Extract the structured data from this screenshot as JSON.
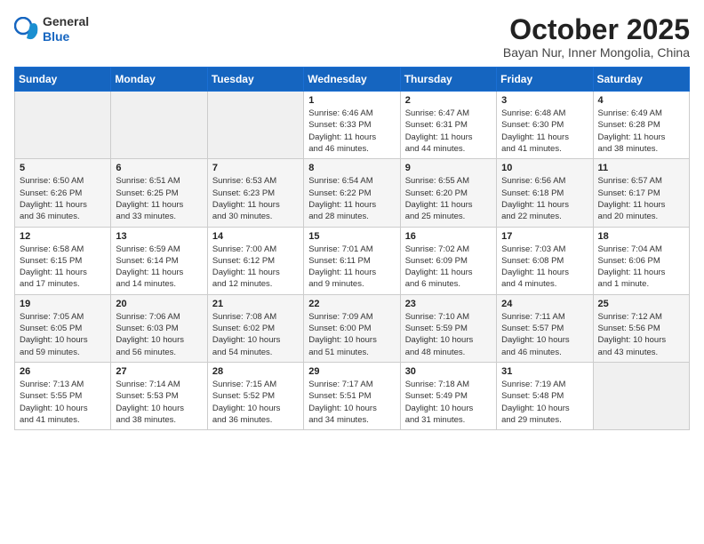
{
  "header": {
    "logo_line1": "General",
    "logo_line2": "Blue",
    "month": "October 2025",
    "location": "Bayan Nur, Inner Mongolia, China"
  },
  "weekdays": [
    "Sunday",
    "Monday",
    "Tuesday",
    "Wednesday",
    "Thursday",
    "Friday",
    "Saturday"
  ],
  "weeks": [
    [
      {
        "day": "",
        "info": ""
      },
      {
        "day": "",
        "info": ""
      },
      {
        "day": "",
        "info": ""
      },
      {
        "day": "1",
        "info": "Sunrise: 6:46 AM\nSunset: 6:33 PM\nDaylight: 11 hours\nand 46 minutes."
      },
      {
        "day": "2",
        "info": "Sunrise: 6:47 AM\nSunset: 6:31 PM\nDaylight: 11 hours\nand 44 minutes."
      },
      {
        "day": "3",
        "info": "Sunrise: 6:48 AM\nSunset: 6:30 PM\nDaylight: 11 hours\nand 41 minutes."
      },
      {
        "day": "4",
        "info": "Sunrise: 6:49 AM\nSunset: 6:28 PM\nDaylight: 11 hours\nand 38 minutes."
      }
    ],
    [
      {
        "day": "5",
        "info": "Sunrise: 6:50 AM\nSunset: 6:26 PM\nDaylight: 11 hours\nand 36 minutes."
      },
      {
        "day": "6",
        "info": "Sunrise: 6:51 AM\nSunset: 6:25 PM\nDaylight: 11 hours\nand 33 minutes."
      },
      {
        "day": "7",
        "info": "Sunrise: 6:53 AM\nSunset: 6:23 PM\nDaylight: 11 hours\nand 30 minutes."
      },
      {
        "day": "8",
        "info": "Sunrise: 6:54 AM\nSunset: 6:22 PM\nDaylight: 11 hours\nand 28 minutes."
      },
      {
        "day": "9",
        "info": "Sunrise: 6:55 AM\nSunset: 6:20 PM\nDaylight: 11 hours\nand 25 minutes."
      },
      {
        "day": "10",
        "info": "Sunrise: 6:56 AM\nSunset: 6:18 PM\nDaylight: 11 hours\nand 22 minutes."
      },
      {
        "day": "11",
        "info": "Sunrise: 6:57 AM\nSunset: 6:17 PM\nDaylight: 11 hours\nand 20 minutes."
      }
    ],
    [
      {
        "day": "12",
        "info": "Sunrise: 6:58 AM\nSunset: 6:15 PM\nDaylight: 11 hours\nand 17 minutes."
      },
      {
        "day": "13",
        "info": "Sunrise: 6:59 AM\nSunset: 6:14 PM\nDaylight: 11 hours\nand 14 minutes."
      },
      {
        "day": "14",
        "info": "Sunrise: 7:00 AM\nSunset: 6:12 PM\nDaylight: 11 hours\nand 12 minutes."
      },
      {
        "day": "15",
        "info": "Sunrise: 7:01 AM\nSunset: 6:11 PM\nDaylight: 11 hours\nand 9 minutes."
      },
      {
        "day": "16",
        "info": "Sunrise: 7:02 AM\nSunset: 6:09 PM\nDaylight: 11 hours\nand 6 minutes."
      },
      {
        "day": "17",
        "info": "Sunrise: 7:03 AM\nSunset: 6:08 PM\nDaylight: 11 hours\nand 4 minutes."
      },
      {
        "day": "18",
        "info": "Sunrise: 7:04 AM\nSunset: 6:06 PM\nDaylight: 11 hours\nand 1 minute."
      }
    ],
    [
      {
        "day": "19",
        "info": "Sunrise: 7:05 AM\nSunset: 6:05 PM\nDaylight: 10 hours\nand 59 minutes."
      },
      {
        "day": "20",
        "info": "Sunrise: 7:06 AM\nSunset: 6:03 PM\nDaylight: 10 hours\nand 56 minutes."
      },
      {
        "day": "21",
        "info": "Sunrise: 7:08 AM\nSunset: 6:02 PM\nDaylight: 10 hours\nand 54 minutes."
      },
      {
        "day": "22",
        "info": "Sunrise: 7:09 AM\nSunset: 6:00 PM\nDaylight: 10 hours\nand 51 minutes."
      },
      {
        "day": "23",
        "info": "Sunrise: 7:10 AM\nSunset: 5:59 PM\nDaylight: 10 hours\nand 48 minutes."
      },
      {
        "day": "24",
        "info": "Sunrise: 7:11 AM\nSunset: 5:57 PM\nDaylight: 10 hours\nand 46 minutes."
      },
      {
        "day": "25",
        "info": "Sunrise: 7:12 AM\nSunset: 5:56 PM\nDaylight: 10 hours\nand 43 minutes."
      }
    ],
    [
      {
        "day": "26",
        "info": "Sunrise: 7:13 AM\nSunset: 5:55 PM\nDaylight: 10 hours\nand 41 minutes."
      },
      {
        "day": "27",
        "info": "Sunrise: 7:14 AM\nSunset: 5:53 PM\nDaylight: 10 hours\nand 38 minutes."
      },
      {
        "day": "28",
        "info": "Sunrise: 7:15 AM\nSunset: 5:52 PM\nDaylight: 10 hours\nand 36 minutes."
      },
      {
        "day": "29",
        "info": "Sunrise: 7:17 AM\nSunset: 5:51 PM\nDaylight: 10 hours\nand 34 minutes."
      },
      {
        "day": "30",
        "info": "Sunrise: 7:18 AM\nSunset: 5:49 PM\nDaylight: 10 hours\nand 31 minutes."
      },
      {
        "day": "31",
        "info": "Sunrise: 7:19 AM\nSunset: 5:48 PM\nDaylight: 10 hours\nand 29 minutes."
      },
      {
        "day": "",
        "info": ""
      }
    ]
  ]
}
